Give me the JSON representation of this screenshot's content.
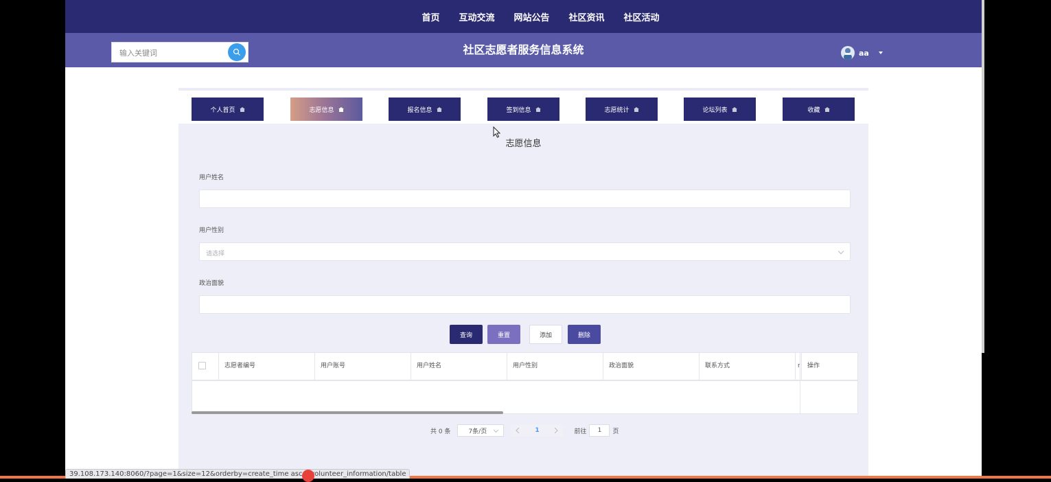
{
  "nav": {
    "items": [
      "首页",
      "互动交流",
      "网站公告",
      "社区资讯",
      "社区活动"
    ]
  },
  "header": {
    "search_placeholder": "输入关键词",
    "site_title": "社区志愿者服务信息系统",
    "username": "aa"
  },
  "tabs": [
    {
      "label": "个人首页",
      "active": false
    },
    {
      "label": "志愿信息",
      "active": true
    },
    {
      "label": "报名信息",
      "active": false
    },
    {
      "label": "签到信息",
      "active": false
    },
    {
      "label": "志愿统计",
      "active": false
    },
    {
      "label": "论坛列表",
      "active": false
    },
    {
      "label": "收藏",
      "active": false
    }
  ],
  "section_title": "志愿信息",
  "form": {
    "name_label": "用户姓名",
    "name_value": "",
    "gender_label": "用户性别",
    "gender_placeholder": "请选择",
    "politics_label": "政治面貌",
    "politics_value": ""
  },
  "buttons": {
    "query": "查询",
    "reset": "重置",
    "add": "添加",
    "delete": "删除"
  },
  "table": {
    "columns": [
      "志愿者编号",
      "用户账号",
      "用户姓名",
      "用户性别",
      "政治面貌",
      "联系方式",
      "操作"
    ],
    "truncated_col_glyph": "r",
    "rows": []
  },
  "pagination": {
    "total_text": "共 0 条",
    "page_size": "7条/页",
    "current_page": "1",
    "goto_prefix": "前往",
    "goto_value": "1",
    "goto_suffix": "页"
  },
  "status_url": "39.108.173.140:8060/?page=1&size=12&orderby=create_time asc#/volunteer_information/table",
  "colors": {
    "nav_bg": "#2a2a72",
    "header_bg": "#5a5aa8",
    "accent_blue": "#3a9eea",
    "btn_reset": "#7b6fc0",
    "btn_delete": "#4a4aa0"
  }
}
